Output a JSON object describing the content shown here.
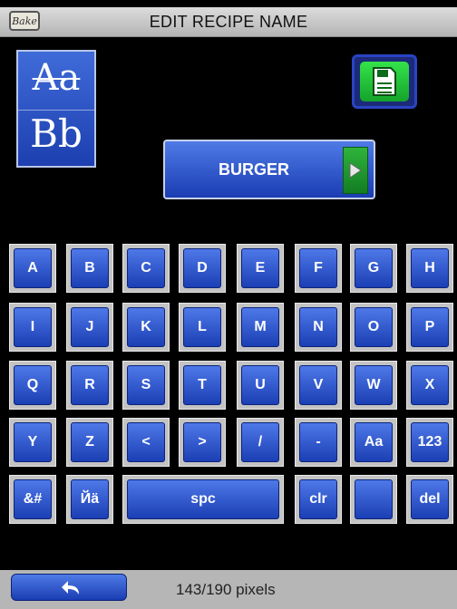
{
  "header": {
    "title": "EDIT RECIPE NAME",
    "logo_text": "Bake"
  },
  "case_toggle": {
    "upper": "Aa",
    "lower": "Bb"
  },
  "save": {
    "icon": "floppy-disk-icon"
  },
  "recipe_name": {
    "value": "BURGER",
    "arrow_icon": "play-arrow-icon"
  },
  "keyboard": {
    "rows": [
      [
        "A",
        "B",
        "C",
        "D",
        "E",
        "F",
        "G",
        "H"
      ],
      [
        "I",
        "J",
        "K",
        "L",
        "M",
        "N",
        "O",
        "P"
      ],
      [
        "Q",
        "R",
        "S",
        "T",
        "U",
        "V",
        "W",
        "X"
      ],
      [
        "Y",
        "Z",
        "<",
        ">",
        "/",
        "-",
        "Aa",
        "123"
      ],
      [
        "&#",
        "Йä",
        "spc",
        "clr",
        "",
        "del"
      ]
    ]
  },
  "footer": {
    "back_icon": "back-arrow-icon",
    "status": "143/190 pixels"
  }
}
